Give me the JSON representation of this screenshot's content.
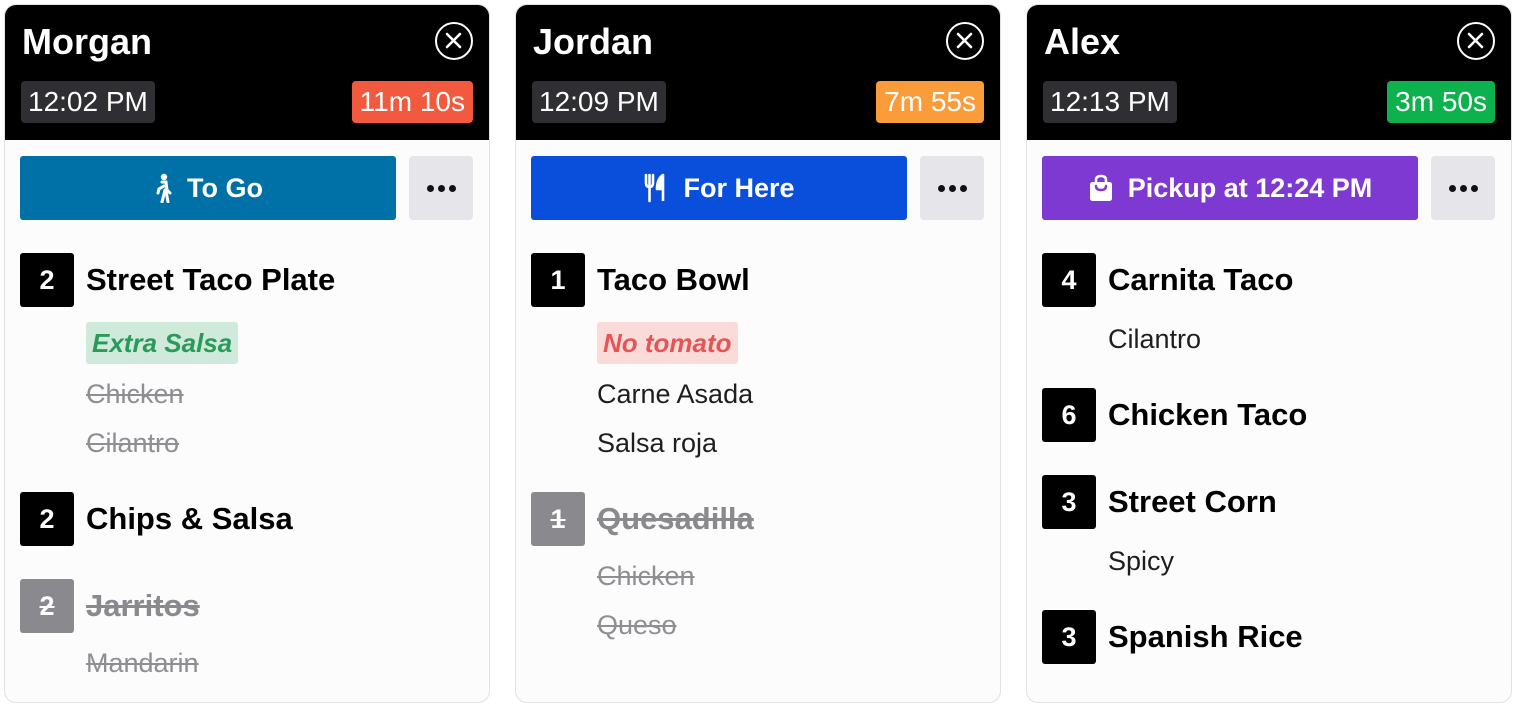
{
  "colors": {
    "header_bg": "#000000",
    "to_go": "#0071a6",
    "for_here": "#0a4fdc",
    "pickup": "#7e39d2",
    "elapsed_red": "#f15a3e",
    "elapsed_orange": "#fb9c3a",
    "elapsed_green": "#0db14d"
  },
  "orders": [
    {
      "name": "Morgan",
      "time": "12:02 PM",
      "elapsed": "11m 10s",
      "order_type": "To Go",
      "order_type_icon": "walking-person-icon",
      "items": [
        {
          "qty": "2",
          "name": "Street Taco Plate",
          "done": false,
          "mods": [
            {
              "text": "Extra Salsa",
              "style": "tag-green"
            },
            {
              "text": "Chicken",
              "style": "done"
            },
            {
              "text": "Cilantro",
              "style": "done"
            }
          ]
        },
        {
          "qty": "2",
          "name": "Chips & Salsa",
          "done": false,
          "mods": []
        },
        {
          "qty": "2",
          "name": "Jarritos",
          "done": true,
          "mods": [
            {
              "text": "Mandarin",
              "style": "done"
            }
          ]
        }
      ]
    },
    {
      "name": "Jordan",
      "time": "12:09 PM",
      "elapsed": "7m 55s",
      "order_type": "For Here",
      "order_type_icon": "fork-knife-icon",
      "items": [
        {
          "qty": "1",
          "name": "Taco Bowl",
          "done": false,
          "mods": [
            {
              "text": "No tomato",
              "style": "tag-red"
            },
            {
              "text": "Carne Asada",
              "style": "normal"
            },
            {
              "text": "Salsa roja",
              "style": "normal"
            }
          ]
        },
        {
          "qty": "1",
          "name": "Quesadilla",
          "done": true,
          "mods": [
            {
              "text": "Chicken",
              "style": "done"
            },
            {
              "text": "Queso",
              "style": "done"
            }
          ]
        }
      ]
    },
    {
      "name": "Alex",
      "time": "12:13 PM",
      "elapsed": "3m 50s",
      "order_type": "Pickup at 12:24 PM",
      "order_type_icon": "shopping-bag-icon",
      "items": [
        {
          "qty": "4",
          "name": "Carnita Taco",
          "done": false,
          "mods": [
            {
              "text": "Cilantro",
              "style": "normal"
            }
          ]
        },
        {
          "qty": "6",
          "name": "Chicken Taco",
          "done": false,
          "mods": []
        },
        {
          "qty": "3",
          "name": "Street Corn",
          "done": false,
          "mods": [
            {
              "text": "Spicy",
              "style": "normal"
            }
          ]
        },
        {
          "qty": "3",
          "name": "Spanish Rice",
          "done": false,
          "mods": []
        }
      ]
    }
  ]
}
